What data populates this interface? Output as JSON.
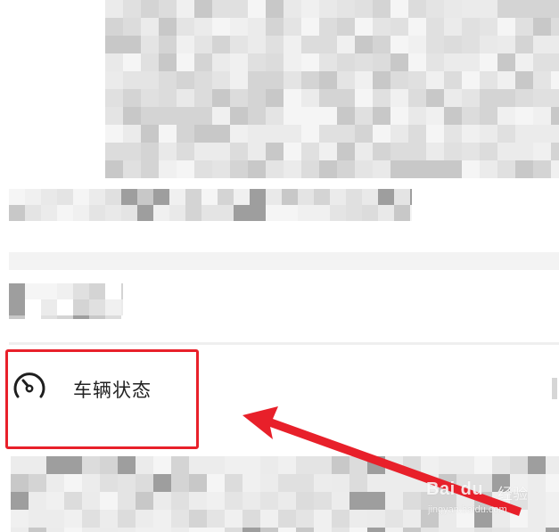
{
  "vehicle_status": {
    "label": "车辆状态",
    "icon": "gauge-icon"
  },
  "annotation": {
    "highlight_color": "#e8202a",
    "arrow_color": "#e8202a"
  },
  "watermark": {
    "brand": "Bai du",
    "product": "经验",
    "url": "jingyan.baidu.com"
  },
  "colors": {
    "background": "#ffffff",
    "blurred_content": "#e5e5e5",
    "text": "#222222"
  }
}
